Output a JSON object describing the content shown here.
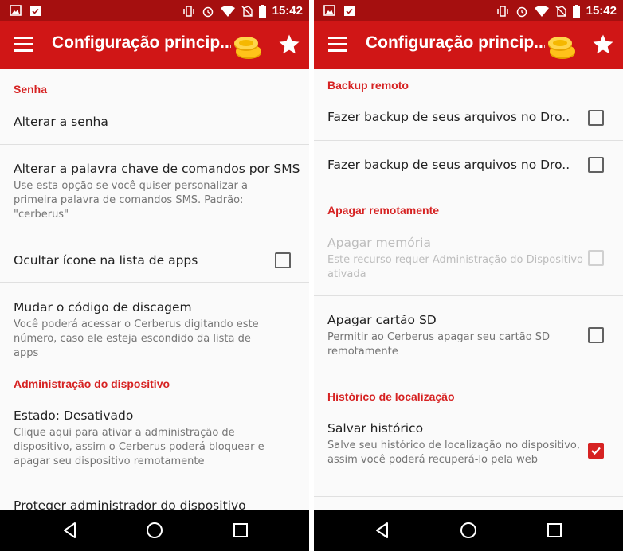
{
  "status_bar": {
    "time": "15:42"
  },
  "left": {
    "title": "Configuração princip...",
    "items": [
      {
        "kind": "section",
        "label": "Senha"
      },
      {
        "kind": "item",
        "title": "Alterar a senha"
      },
      {
        "kind": "item",
        "title": "Alterar a palavra chave de comandos por SMS",
        "subtitle": "Use esta opção se você quiser personalizar a primeira palavra de comandos SMS. Padrão: \"cerberus\""
      },
      {
        "kind": "item",
        "title": "Ocultar ícone na lista de apps",
        "checkbox": "unchecked"
      },
      {
        "kind": "item",
        "title": "Mudar o código de discagem",
        "subtitle": "Você poderá acessar o Cerberus digitando este número, caso ele esteja escondido da lista de apps"
      },
      {
        "kind": "section",
        "label": "Administração do dispositivo"
      },
      {
        "kind": "item",
        "title": "Estado: Desativado",
        "subtitle": "Clique aqui para ativar a administração de dispositivo, assim o Cerberus poderá bloquear e apagar seu dispositivo remotamente"
      },
      {
        "kind": "item",
        "title": "Proteger administrador do dispositivo"
      }
    ]
  },
  "right": {
    "title": "Configuração princip...",
    "items": [
      {
        "kind": "section",
        "label": "Backup remoto"
      },
      {
        "kind": "item",
        "title": "Fazer backup de seus arquivos no Dro..",
        "checkbox": "unchecked"
      },
      {
        "kind": "item",
        "title": "Fazer backup de seus arquivos no Dro..",
        "checkbox": "unchecked"
      },
      {
        "kind": "section",
        "label": "Apagar remotamente"
      },
      {
        "kind": "item",
        "title": "Apagar memória",
        "subtitle": "Este recurso requer Administração do Dispositivo ativada",
        "checkbox": "disabled",
        "disabled": true
      },
      {
        "kind": "item",
        "title": "Apagar cartão SD",
        "subtitle": "Permitir ao Cerberus apagar seu cartão SD remotamente",
        "checkbox": "unchecked"
      },
      {
        "kind": "section",
        "label": "Histórico de localização"
      },
      {
        "kind": "item",
        "title": "Salvar histórico",
        "subtitle": "Salve seu histórico de localização no dispositivo, assim você poderá recuperá-lo pela web",
        "checkbox": "checked"
      }
    ]
  },
  "colors": {
    "status_bar": "#a50f0f",
    "toolbar": "#d01616",
    "accent": "#d62222"
  },
  "icons": [
    "image-icon",
    "clipboard-check-icon",
    "vibrate-icon",
    "alarm-icon",
    "wifi-icon",
    "no-sim-icon",
    "battery-icon",
    "menu-icon",
    "coins-icon",
    "star-icon",
    "back-icon",
    "home-icon",
    "recents-icon"
  ]
}
